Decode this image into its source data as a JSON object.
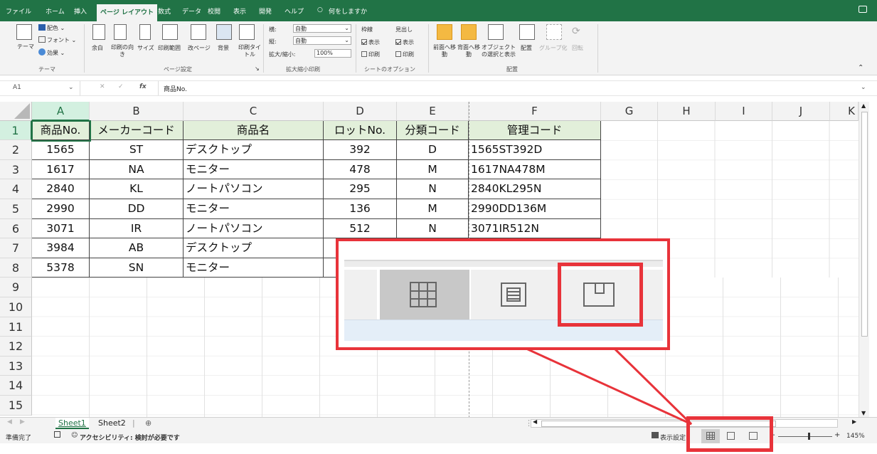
{
  "ribbon_tabs": [
    "ファイル",
    "ホーム",
    "挿入",
    "ページ レイアウト",
    "数式",
    "データ",
    "校閲",
    "表示",
    "開発",
    "ヘルプ"
  ],
  "active_tab": "ページ レイアウト",
  "tell_me": "何をしますか",
  "ribbon": {
    "theme": {
      "theme_label": "テーマ",
      "colors": "配色",
      "fonts": "フォント",
      "effects": "効果",
      "group": "テーマ"
    },
    "page_setup": {
      "margins": "余白",
      "orientation": "印刷の向き",
      "size": "サイズ",
      "print_area": "印刷範囲",
      "breaks": "改ページ",
      "background": "背景",
      "print_titles": "印刷タイトル",
      "group": "ページ設定"
    },
    "scale": {
      "width_label": "横:",
      "width_value": "自動",
      "height_label": "縦:",
      "height_value": "自動",
      "scale_label": "拡大/縮小:",
      "scale_value": "100%",
      "group": "拡大縮小印刷"
    },
    "sheet_options": {
      "gridlines": "枠線",
      "headings": "見出し",
      "view": "表示",
      "print": "印刷",
      "group": "シートのオプション"
    },
    "arrange": {
      "bring_forward": "前面へ移動",
      "send_backward": "背面へ移動",
      "selection_pane": "オブジェクトの選択と表示",
      "align": "配置",
      "group_btn": "グループ化",
      "rotate": "回転",
      "group": "配置"
    }
  },
  "name_box": "A1",
  "formula_value": "商品No.",
  "column_headers": [
    "A",
    "B",
    "C",
    "D",
    "E",
    "F",
    "G",
    "H",
    "I",
    "J",
    "K"
  ],
  "row_numbers": [
    "1",
    "2",
    "3",
    "4",
    "5",
    "6",
    "7",
    "8",
    "9",
    "10",
    "11",
    "12",
    "13",
    "14",
    "15"
  ],
  "table": {
    "headers": [
      "商品No.",
      "メーカーコード",
      "商品名",
      "ロットNo.",
      "分類コード",
      "管理コード"
    ],
    "rows": [
      [
        "1565",
        "ST",
        "デスクトップ",
        "392",
        "D",
        "1565ST392D"
      ],
      [
        "1617",
        "NA",
        "モニター",
        "478",
        "M",
        "1617NA478M"
      ],
      [
        "2840",
        "KL",
        "ノートパソコン",
        "295",
        "N",
        "2840KL295N"
      ],
      [
        "2990",
        "DD",
        "モニター",
        "136",
        "M",
        "2990DD136M"
      ],
      [
        "3071",
        "IR",
        "ノートパソコン",
        "512",
        "N",
        "3071IR512N"
      ],
      [
        "3984",
        "AB",
        "デスクトップ",
        "",
        "",
        ""
      ],
      [
        "5378",
        "SN",
        "モニター",
        "",
        "",
        ""
      ]
    ]
  },
  "sheets": [
    "Sheet1",
    "Sheet2"
  ],
  "active_sheet": "Sheet1",
  "status": {
    "ready": "準備完了",
    "accessibility": "アクセシビリティ: 検討が必要です",
    "display_settings": "表示設定",
    "zoom": "145%"
  },
  "colors": {
    "excel_green": "#217346",
    "header_fill": "#e2efda",
    "callout_red": "#e8333a"
  }
}
